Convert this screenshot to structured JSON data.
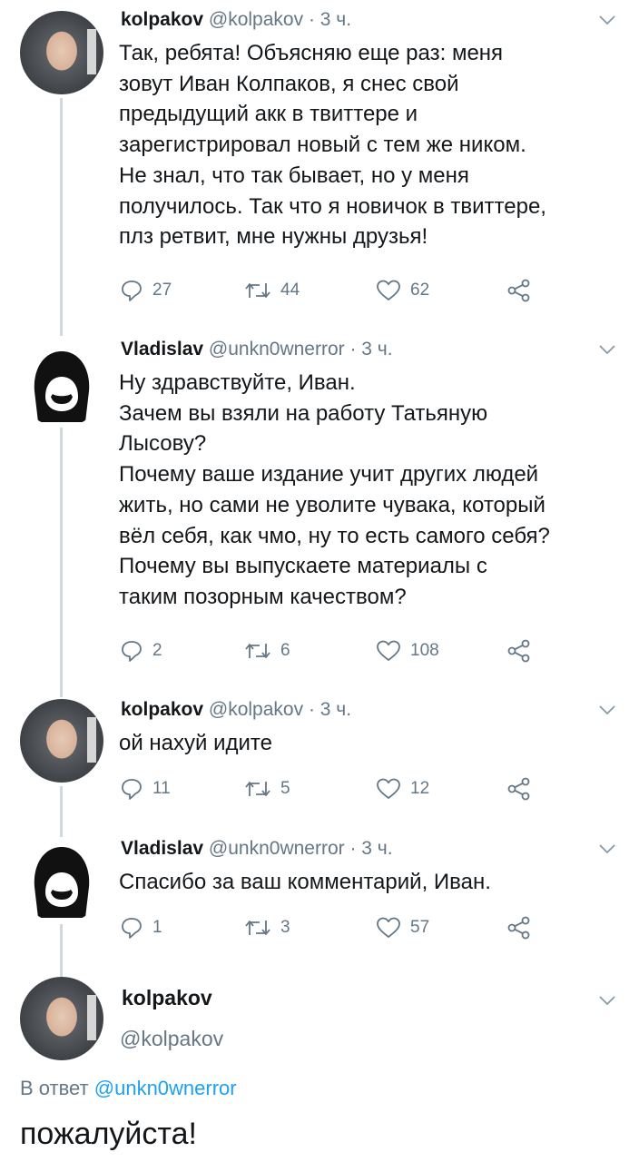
{
  "tweets": [
    {
      "name": "kolpakov",
      "handle": "@kolpakov",
      "time": "· 3 ч.",
      "text": "Так, ребята! Объясняю еще раз: меня\nзовут Иван Колпаков, я снес свой\nпредыдущий акк в твиттере и\nзарегистрировал новый с тем же ником.\nНе знал, что так бывает, но у меня\nполучилось. Так что я новичок в твиттере,\nплз ретвит, мне нужны друзья!",
      "replies": "27",
      "retweets": "44",
      "likes": "62",
      "avatar": "photo-avatar"
    },
    {
      "name": "Vladislav",
      "handle": "@unkn0wnerror",
      "time": "· 3 ч.",
      "text": "Ну здравствуйте, Иван.\nЗачем вы взяли на работу Татьяную\nЛысову?\nПочему ваше издание учит других людей\nжить, но сами не уволите чувака, который\nвёл себя, как чмо, ну то есть самого себя?\nПочему вы выпускаете материалы с\nтаким позорным качеством?",
      "replies": "2",
      "retweets": "6",
      "likes": "108",
      "avatar": "hood-avatar"
    },
    {
      "name": "kolpakov",
      "handle": "@kolpakov",
      "time": "· 3 ч.",
      "text": "ой нахуй идите",
      "replies": "11",
      "retweets": "5",
      "likes": "12",
      "avatar": "photo-avatar"
    },
    {
      "name": "Vladislav",
      "handle": "@unkn0wnerror",
      "time": "· 3 ч.",
      "text": "Спасибо за ваш комментарий, Иван.",
      "replies": "1",
      "retweets": "3",
      "likes": "57",
      "avatar": "hood-avatar"
    }
  ],
  "focused_tweet": {
    "name": "kolpakov",
    "handle": "@kolpakov",
    "reply_prefix": "В ответ",
    "reply_mention": "@unkn0wnerror",
    "text": "пожалуйста!"
  },
  "colors": {
    "text": "#14171a",
    "secondary": "#657786",
    "link": "#1da1f2",
    "thread_line": "#cfd9de"
  },
  "icons": [
    "chevron-down-icon",
    "reply-icon",
    "retweet-icon",
    "like-icon",
    "share-icon"
  ]
}
